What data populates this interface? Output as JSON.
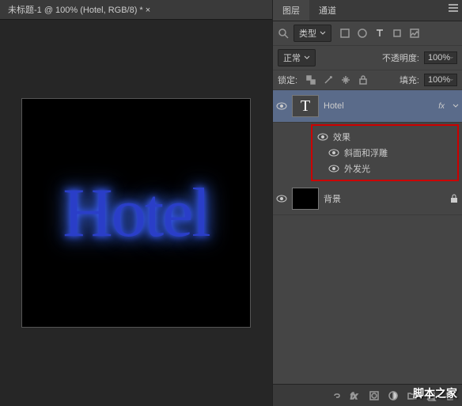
{
  "doc_tab": "未标题-1 @ 100% (Hotel, RGB/8) * ×",
  "canvas_text": "Hotel",
  "panel": {
    "tabs": [
      "图层",
      "通道"
    ],
    "filter_label": "类型",
    "blend_mode": "正常",
    "opacity_label": "不透明度:",
    "opacity_value": "100%",
    "lock_label": "锁定:",
    "fill_label": "填充:",
    "fill_value": "100%"
  },
  "layers": {
    "text": {
      "name": "Hotel",
      "thumb": "T",
      "fx_badge": "fx"
    },
    "effects_title": "效果",
    "effect1": "斜面和浮雕",
    "effect2": "外发光",
    "bg": {
      "name": "背景"
    }
  },
  "watermark": "脚本之家"
}
